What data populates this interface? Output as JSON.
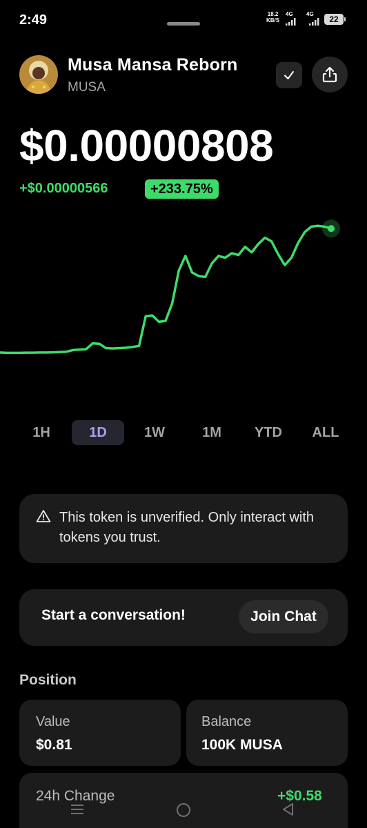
{
  "status_bar": {
    "time": "2:49",
    "speed_value": "18.2",
    "speed_unit": "KB/S",
    "network_1": "4G",
    "network_2": "4G",
    "battery": "22"
  },
  "token": {
    "name": "Musa Mansa Reborn",
    "symbol": "MUSA",
    "price": "$0.00000808",
    "change_abs": "+$0.00000566",
    "change_pct": "+233.75%"
  },
  "colors": {
    "accent_green": "#3ddc6a",
    "active_tab": "#a9a2f0",
    "card_bg": "#1c1c1c"
  },
  "icons": [
    "check-icon",
    "share-icon",
    "warning-icon",
    "menu-icon",
    "home-icon",
    "back-icon"
  ],
  "range_tabs": [
    "1H",
    "1D",
    "1W",
    "1M",
    "YTD",
    "ALL"
  ],
  "active_range": "1D",
  "chart_data": {
    "type": "line",
    "title": "",
    "xlabel": "",
    "ylabel": "",
    "x": [
      0,
      1,
      2,
      3,
      4,
      5,
      6,
      7,
      8,
      9,
      10,
      11,
      12,
      13,
      14,
      15,
      16,
      17,
      18,
      19,
      20,
      21,
      22,
      23,
      24,
      25,
      26,
      27,
      28,
      29,
      30,
      31,
      32,
      33,
      34,
      35,
      36,
      37,
      38,
      39,
      40,
      41,
      42,
      43,
      44,
      45,
      46,
      47,
      48,
      49,
      50
    ],
    "values": [
      2.42,
      2.4,
      2.4,
      2.4,
      2.41,
      2.41,
      2.42,
      2.42,
      2.43,
      2.44,
      2.46,
      2.55,
      2.58,
      2.6,
      2.92,
      2.9,
      2.66,
      2.64,
      2.66,
      2.68,
      2.72,
      2.78,
      4.4,
      4.45,
      4.1,
      4.15,
      5.1,
      6.9,
      7.7,
      6.8,
      6.6,
      6.55,
      7.3,
      7.7,
      7.6,
      7.85,
      7.75,
      8.2,
      7.9,
      8.35,
      8.7,
      8.5,
      7.8,
      7.2,
      7.6,
      8.4,
      9.0,
      9.3,
      9.35,
      9.3,
      9.2
    ],
    "ylim": [
      0,
      10
    ],
    "grid": false,
    "legend": "none"
  },
  "warning": {
    "text": "This token is unverified. Only interact with tokens you trust."
  },
  "chat": {
    "prompt": "Start a conversation!",
    "button": "Join Chat"
  },
  "position": {
    "title": "Position",
    "value_label": "Value",
    "value": "$0.81",
    "balance_label": "Balance",
    "balance": "100K MUSA",
    "change_label": "24h Change",
    "change_value": "+$0.58"
  }
}
